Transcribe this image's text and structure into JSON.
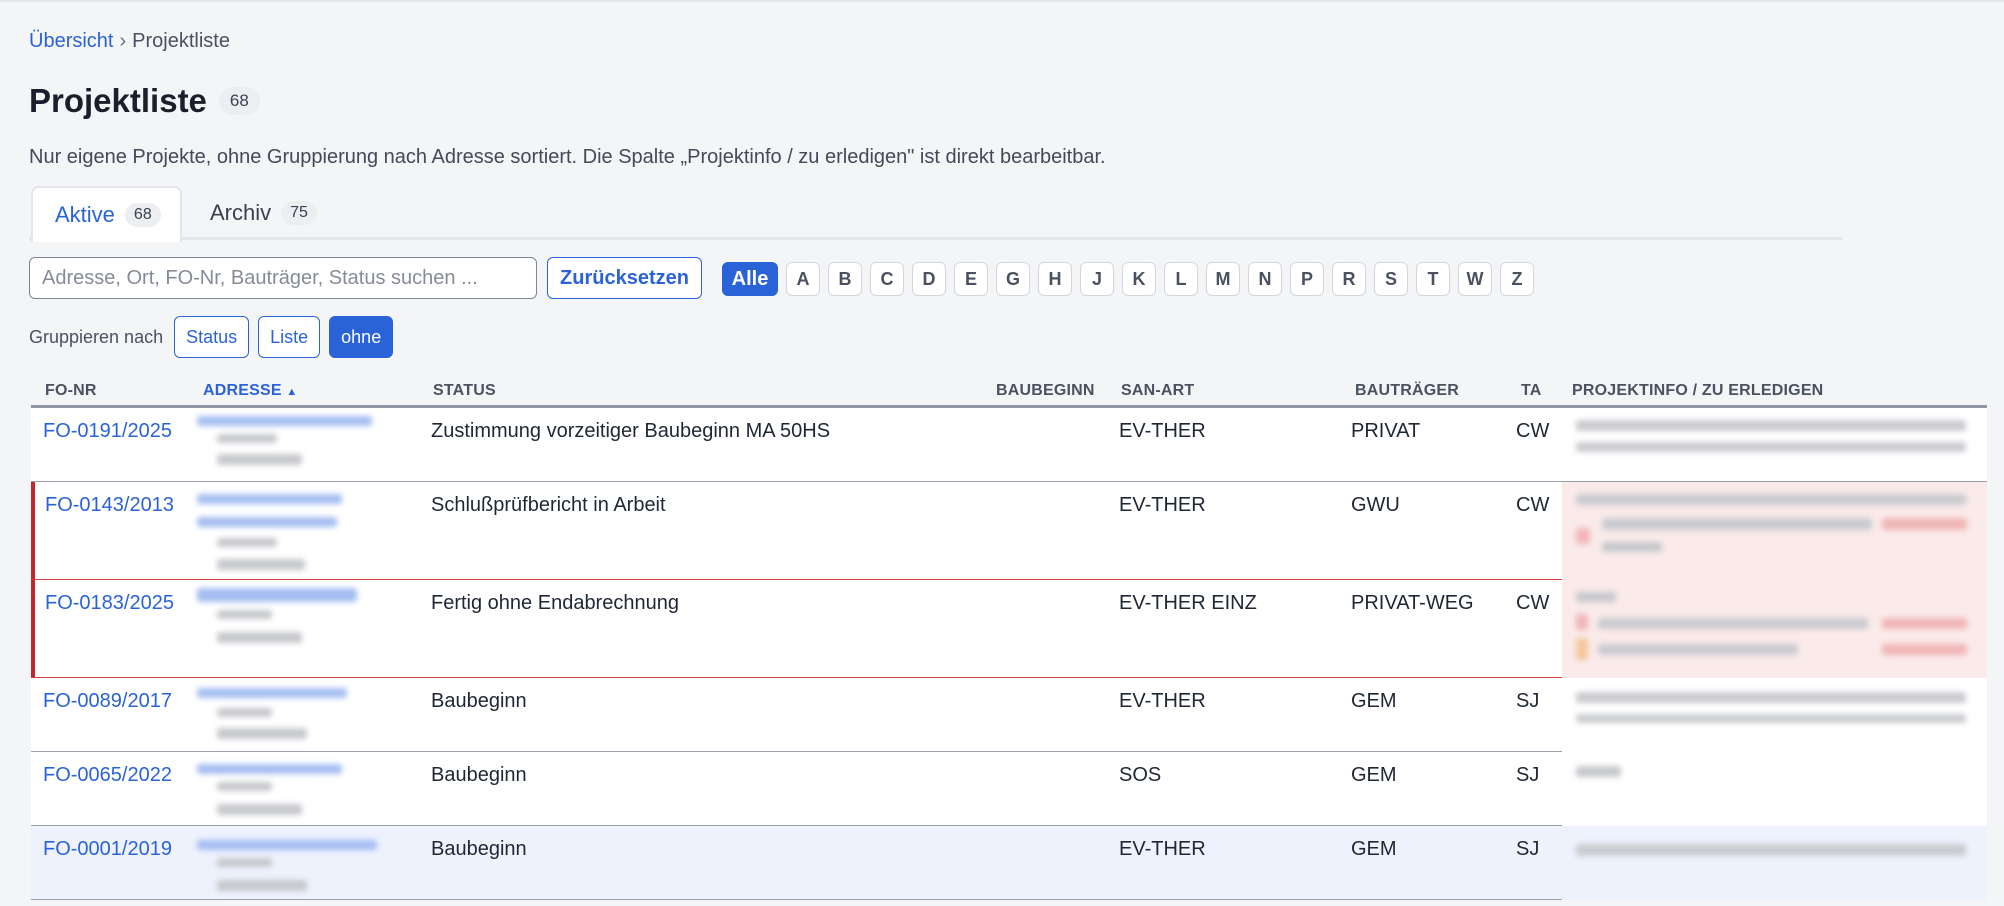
{
  "breadcrumb": {
    "home": "Übersicht",
    "separator": "›",
    "current": "Projektliste"
  },
  "page": {
    "title": "Projektliste",
    "count": "68",
    "subtitle": "Nur eigene Projekte, ohne Gruppierung nach Adresse sortiert. Die Spalte „Projektinfo / zu erledigen\" ist direkt bearbeitbar."
  },
  "tabs": [
    {
      "label": "Aktive",
      "count": "68",
      "active": true
    },
    {
      "label": "Archiv",
      "count": "75",
      "active": false
    }
  ],
  "search": {
    "placeholder": "Adresse, Ort, FO-Nr, Bauträger, Status suchen ...",
    "value": ""
  },
  "reset_label": "Zurücksetzen",
  "letters": [
    "Alle",
    "A",
    "B",
    "C",
    "D",
    "E",
    "G",
    "H",
    "J",
    "K",
    "L",
    "M",
    "N",
    "P",
    "R",
    "S",
    "T",
    "W",
    "Z"
  ],
  "active_letter": "Alle",
  "grouping": {
    "label": "Gruppieren nach",
    "options": [
      "Status",
      "Liste",
      "ohne"
    ],
    "active": "ohne"
  },
  "table": {
    "columns": [
      "FO-NR",
      "ADRESSE",
      "STATUS",
      "BAUBEGINN",
      "SAN-ART",
      "BAUTRÄGER",
      "TA",
      "PROJEKTINFO / ZU ERLEDIGEN"
    ],
    "sort_indicator": "▲",
    "rows": [
      {
        "fo_nr": "FO-0191/2025",
        "status": "Zustimmung vorzeitiger Baubeginn MA 50HS",
        "baubeginn": "",
        "san_art": "EV-THER",
        "bautraeger": "PRIVAT",
        "ta": "CW"
      },
      {
        "fo_nr": "FO-0143/2013",
        "status": "Schlußprüfbericht in Arbeit",
        "baubeginn": "",
        "san_art": "EV-THER",
        "bautraeger": "GWU",
        "ta": "CW"
      },
      {
        "fo_nr": "FO-0183/2025",
        "status": "Fertig ohne Endabrechnung",
        "baubeginn": "",
        "san_art": "EV-THER EINZ",
        "bautraeger": "PRIVAT-WEG",
        "ta": "CW"
      },
      {
        "fo_nr": "FO-0089/2017",
        "status": "Baubeginn",
        "baubeginn": "",
        "san_art": "EV-THER",
        "bautraeger": "GEM",
        "ta": "SJ"
      },
      {
        "fo_nr": "FO-0065/2022",
        "status": "Baubeginn",
        "baubeginn": "",
        "san_art": "SOS",
        "bautraeger": "GEM",
        "ta": "SJ"
      },
      {
        "fo_nr": "FO-0001/2019",
        "status": "Baubeginn",
        "baubeginn": "",
        "san_art": "EV-THER",
        "bautraeger": "GEM",
        "ta": "SJ"
      }
    ]
  },
  "colors": {
    "accent": "#2a63d8",
    "flag": "#c3272b",
    "highlight_row": "#eef2fd"
  }
}
